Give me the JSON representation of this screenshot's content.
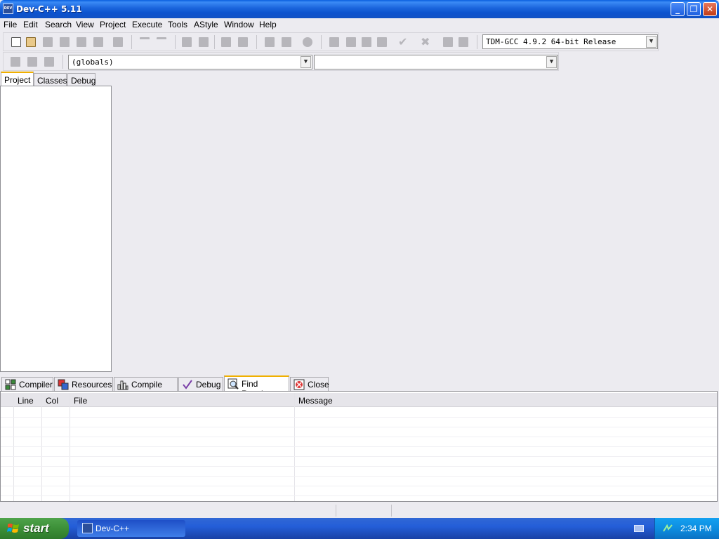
{
  "window": {
    "title": "Dev-C++ 5.11",
    "icon_label": "DEV",
    "controls": {
      "minimize": "_",
      "restore": "❐",
      "close": "✕"
    }
  },
  "menu": [
    "File",
    "Edit",
    "Search",
    "View",
    "Project",
    "Execute",
    "Tools",
    "AStyle",
    "Window",
    "Help"
  ],
  "toolbar": {
    "compiler_select": "TDM-GCC 4.9.2 64-bit Release",
    "scope_select": "(globals)",
    "member_select": ""
  },
  "left_tabs": [
    "Project",
    "Classes",
    "Debug"
  ],
  "bottom_tabs": [
    "Compiler",
    "Resources",
    "Compile Log",
    "Debug",
    "Find Results",
    "Close"
  ],
  "results_table": {
    "columns": [
      "Line",
      "Col",
      "File",
      "Message"
    ]
  },
  "taskbar": {
    "start": "start",
    "items": [
      "Dev-C++"
    ],
    "clock": "2:34 PM"
  }
}
